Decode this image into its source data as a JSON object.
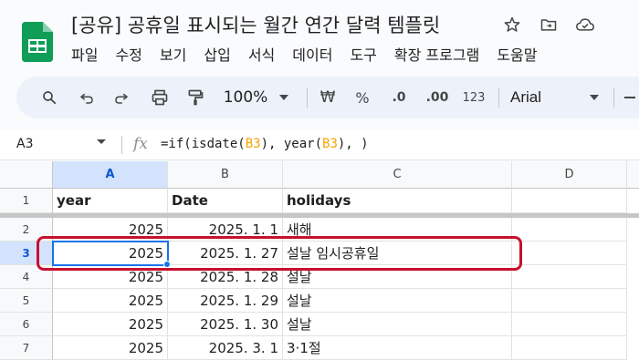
{
  "app": {
    "title": "[공유] 공휴일 표시되는 월간 연간 달력 템플릿",
    "logo_icon": "google-sheets-logo",
    "title_icons": [
      "star-icon",
      "move-to-folder-icon",
      "cloud-status-icon"
    ]
  },
  "menu": [
    "파일",
    "수정",
    "보기",
    "삽입",
    "서식",
    "데이터",
    "도구",
    "확장 프로그램",
    "도움말"
  ],
  "toolbar": {
    "zoom": "100%",
    "currency": "₩",
    "percent": "%",
    "decrease_decimal": ".0",
    "increase_decimal": ".00",
    "number_format": "123",
    "font": "Arial"
  },
  "formula_bar": {
    "name_box": "A3",
    "fx": "fx",
    "formula_parts": [
      "=if(isdate(",
      "B3",
      "), year(",
      "B3",
      "), )"
    ]
  },
  "sheet": {
    "columns": [
      "A",
      "B",
      "C",
      "D"
    ],
    "rows": [
      {
        "num": "1",
        "a": "year",
        "b": "Date",
        "c": "holidays"
      },
      {
        "num": "2",
        "a": "2025",
        "b": "2025. 1. 1",
        "c": "새해"
      },
      {
        "num": "3",
        "a": "2025",
        "b": "2025. 1. 27",
        "c": "설날 임시공휴일"
      },
      {
        "num": "4",
        "a": "2025",
        "b": "2025. 1. 28",
        "c": "설날"
      },
      {
        "num": "5",
        "a": "2025",
        "b": "2025. 1. 29",
        "c": "설날"
      },
      {
        "num": "6",
        "a": "2025",
        "b": "2025. 1. 30",
        "c": "설날"
      },
      {
        "num": "7",
        "a": "2025",
        "b": "2025. 3. 1",
        "c": "3·1절"
      }
    ],
    "selected_cell": "A3",
    "accent": "#1a73e8",
    "annotation_color": "#c8102e"
  }
}
